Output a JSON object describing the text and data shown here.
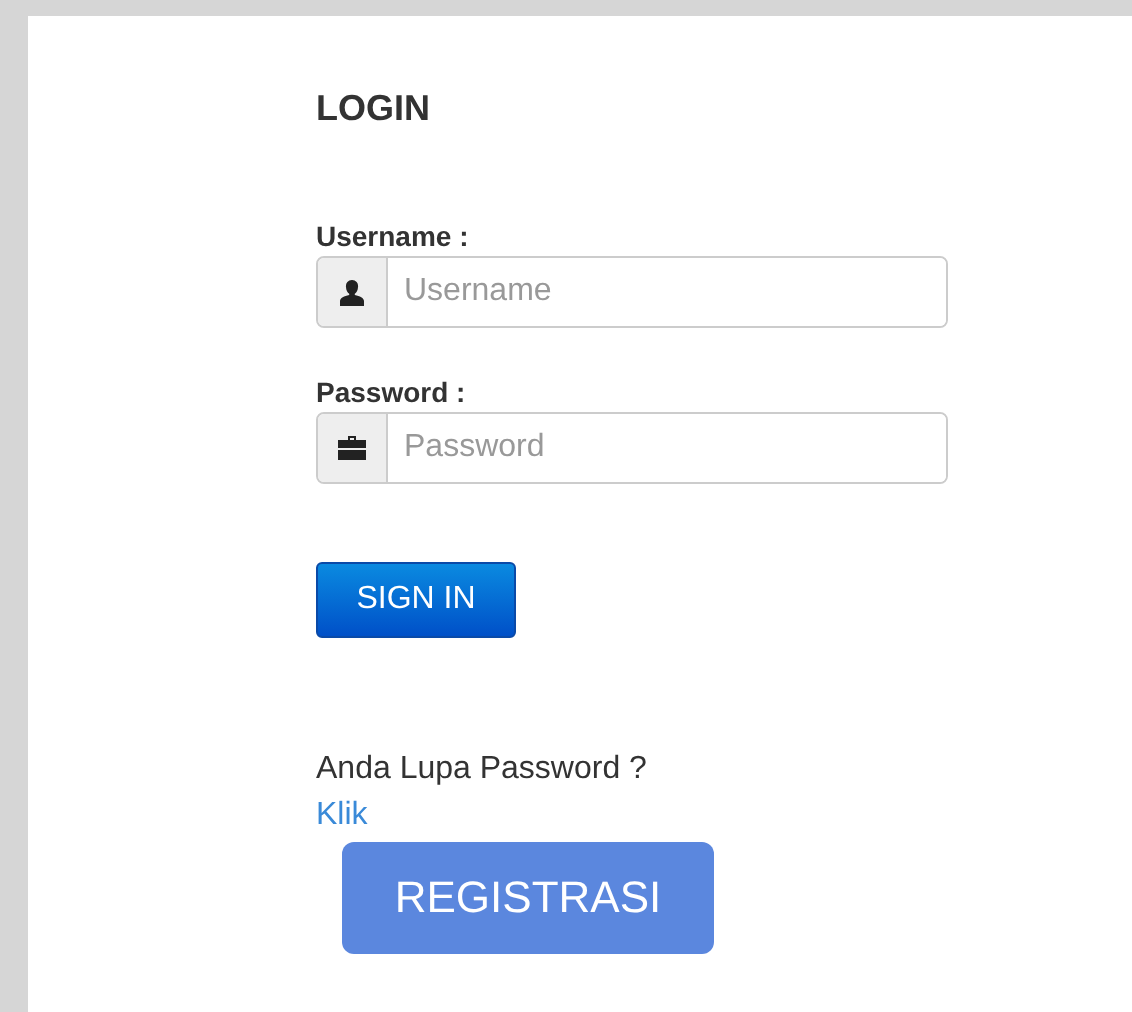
{
  "title": "LOGIN",
  "fields": [
    {
      "label": "Username :",
      "placeholder": "Username",
      "kind": "user"
    },
    {
      "label": "Password :",
      "placeholder": "Password",
      "kind": "password"
    }
  ],
  "sign_in": "SIGN IN",
  "forgot": {
    "text": "Anda Lupa Password ?",
    "link": "Klik"
  },
  "register": "REGISTRASI"
}
